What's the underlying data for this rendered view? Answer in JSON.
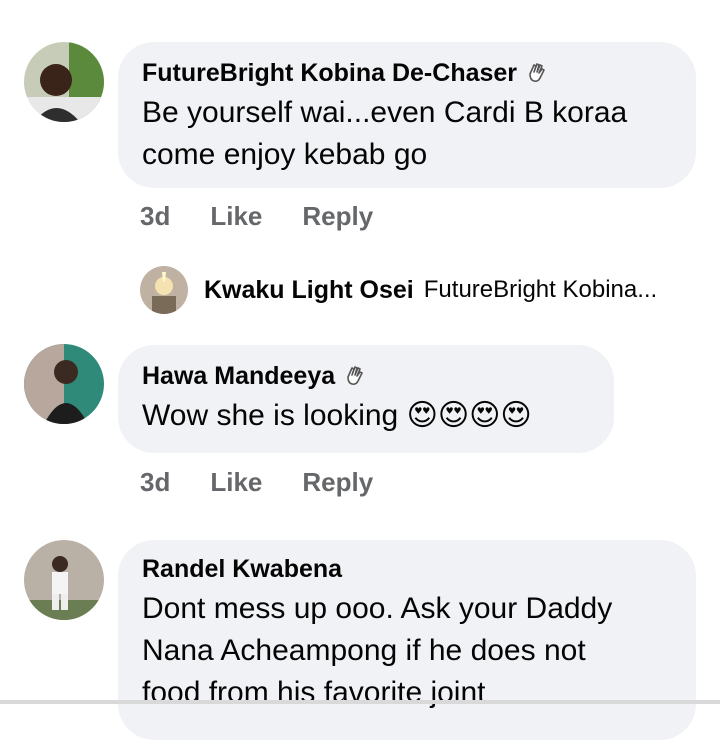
{
  "comments": [
    {
      "author": "FutureBright Kobina De-Chaser",
      "text_line1": "Be yourself wai...even Cardi B koraa",
      "text_line2": "come enjoy kebab go",
      "time": "3d",
      "like": "Like",
      "reply": "Reply",
      "badge_icon": "waving-hand-icon"
    },
    {
      "author": "Hawa Mandeeya",
      "text": "Wow she is looking",
      "emojis": "😍😍😍😍",
      "time": "3d",
      "like": "Like",
      "reply": "Reply",
      "badge_icon": "waving-hand-icon"
    },
    {
      "author": "Randel Kwabena",
      "text_line1": "Dont mess up ooo. Ask your Daddy",
      "text_line2": "Nana Acheampong if he does not",
      "text_line3": "food from his favorite joint"
    }
  ],
  "reply_preview": {
    "author": "Kwaku Light Osei",
    "preview": "FutureBright Kobina..."
  },
  "colors": {
    "bubble": "#f0f2f5",
    "meta_text": "#65676b"
  }
}
